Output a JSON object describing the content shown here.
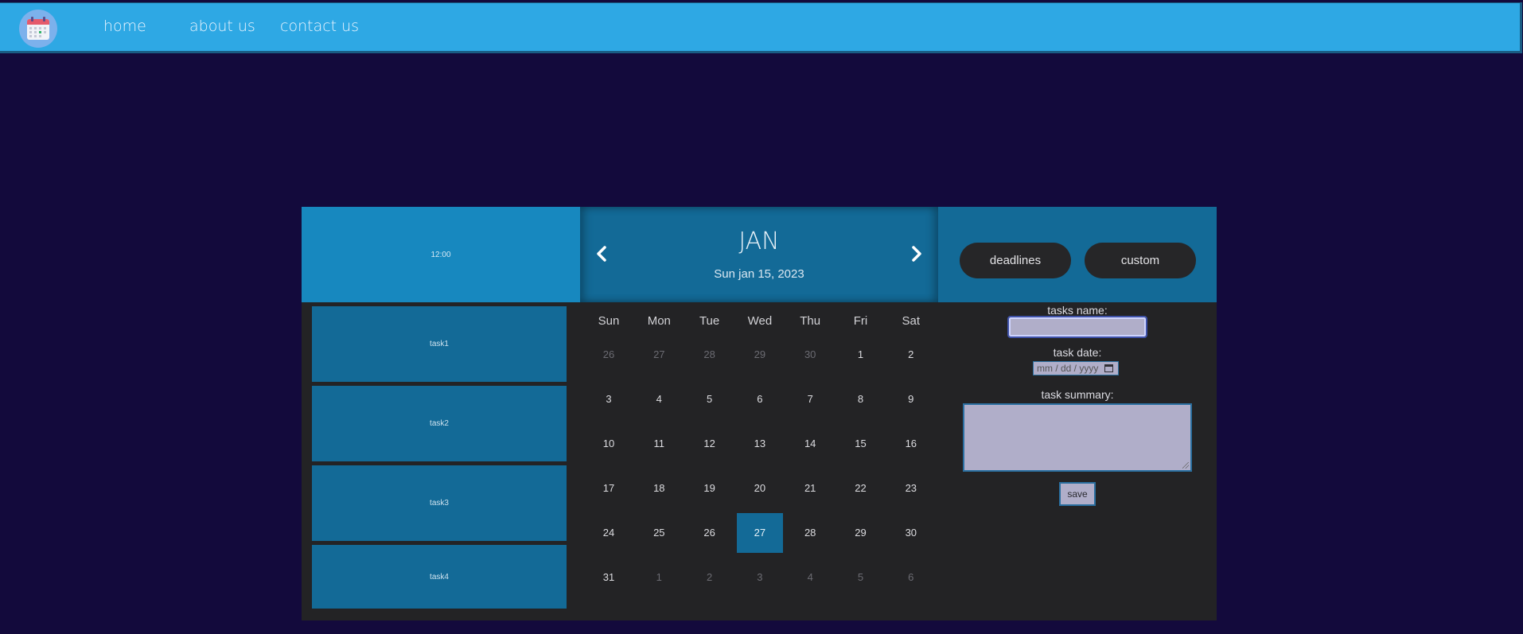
{
  "nav": {
    "logo_icon": "calendar-icon",
    "links": [
      "home",
      "about us",
      "contact us"
    ]
  },
  "time_panel": {
    "time": "12:00"
  },
  "tasks": [
    "task1",
    "task2",
    "task3",
    "task4"
  ],
  "calendar": {
    "month": "JAN",
    "selected_date": "Sun jan 15, 2023",
    "prev_icon": "chevron-left-icon",
    "next_icon": "chevron-right-icon",
    "weekdays": [
      "Sun",
      "Mon",
      "Tue",
      "Wed",
      "Thu",
      "Fri",
      "Sat"
    ],
    "days": [
      {
        "label": "26",
        "muted": true
      },
      {
        "label": "27",
        "muted": true
      },
      {
        "label": "28",
        "muted": true
      },
      {
        "label": "29",
        "muted": true
      },
      {
        "label": "30",
        "muted": true
      },
      {
        "label": "1",
        "muted": false
      },
      {
        "label": "2",
        "muted": false
      },
      {
        "label": "3",
        "muted": false
      },
      {
        "label": "4",
        "muted": false
      },
      {
        "label": "5",
        "muted": false
      },
      {
        "label": "6",
        "muted": false
      },
      {
        "label": "7",
        "muted": false
      },
      {
        "label": "8",
        "muted": false
      },
      {
        "label": "9",
        "muted": false
      },
      {
        "label": "10",
        "muted": false
      },
      {
        "label": "11",
        "muted": false
      },
      {
        "label": "12",
        "muted": false
      },
      {
        "label": "13",
        "muted": false
      },
      {
        "label": "14",
        "muted": false
      },
      {
        "label": "15",
        "muted": false
      },
      {
        "label": "16",
        "muted": false
      },
      {
        "label": "17",
        "muted": false
      },
      {
        "label": "18",
        "muted": false
      },
      {
        "label": "19",
        "muted": false
      },
      {
        "label": "20",
        "muted": false
      },
      {
        "label": "21",
        "muted": false
      },
      {
        "label": "22",
        "muted": false
      },
      {
        "label": "23",
        "muted": false
      },
      {
        "label": "24",
        "muted": false
      },
      {
        "label": "25",
        "muted": false
      },
      {
        "label": "26",
        "muted": false
      },
      {
        "label": "27",
        "muted": false,
        "active": true
      },
      {
        "label": "28",
        "muted": false
      },
      {
        "label": "29",
        "muted": false
      },
      {
        "label": "30",
        "muted": false
      },
      {
        "label": "31",
        "muted": false
      },
      {
        "label": "1",
        "muted": true
      },
      {
        "label": "2",
        "muted": true
      },
      {
        "label": "3",
        "muted": true
      },
      {
        "label": "4",
        "muted": true
      },
      {
        "label": "5",
        "muted": true
      },
      {
        "label": "6",
        "muted": true
      }
    ]
  },
  "filters": {
    "deadlines": "deadlines",
    "custom": "custom"
  },
  "form": {
    "name_label": "tasks name:",
    "name_value": "",
    "date_label": "task date:",
    "date_placeholder": "mm / dd / yyyy",
    "date_icon": "calendar-picker-icon",
    "summary_label": "task summary:",
    "summary_value": "",
    "save_label": "save"
  },
  "colors": {
    "page_bg": "#130a3c",
    "navbar": "#2ea8e4",
    "panel_dark": "#232325",
    "accent": "#136a97",
    "accent_light": "#1788bf",
    "input_bg": "#b0aec9"
  }
}
